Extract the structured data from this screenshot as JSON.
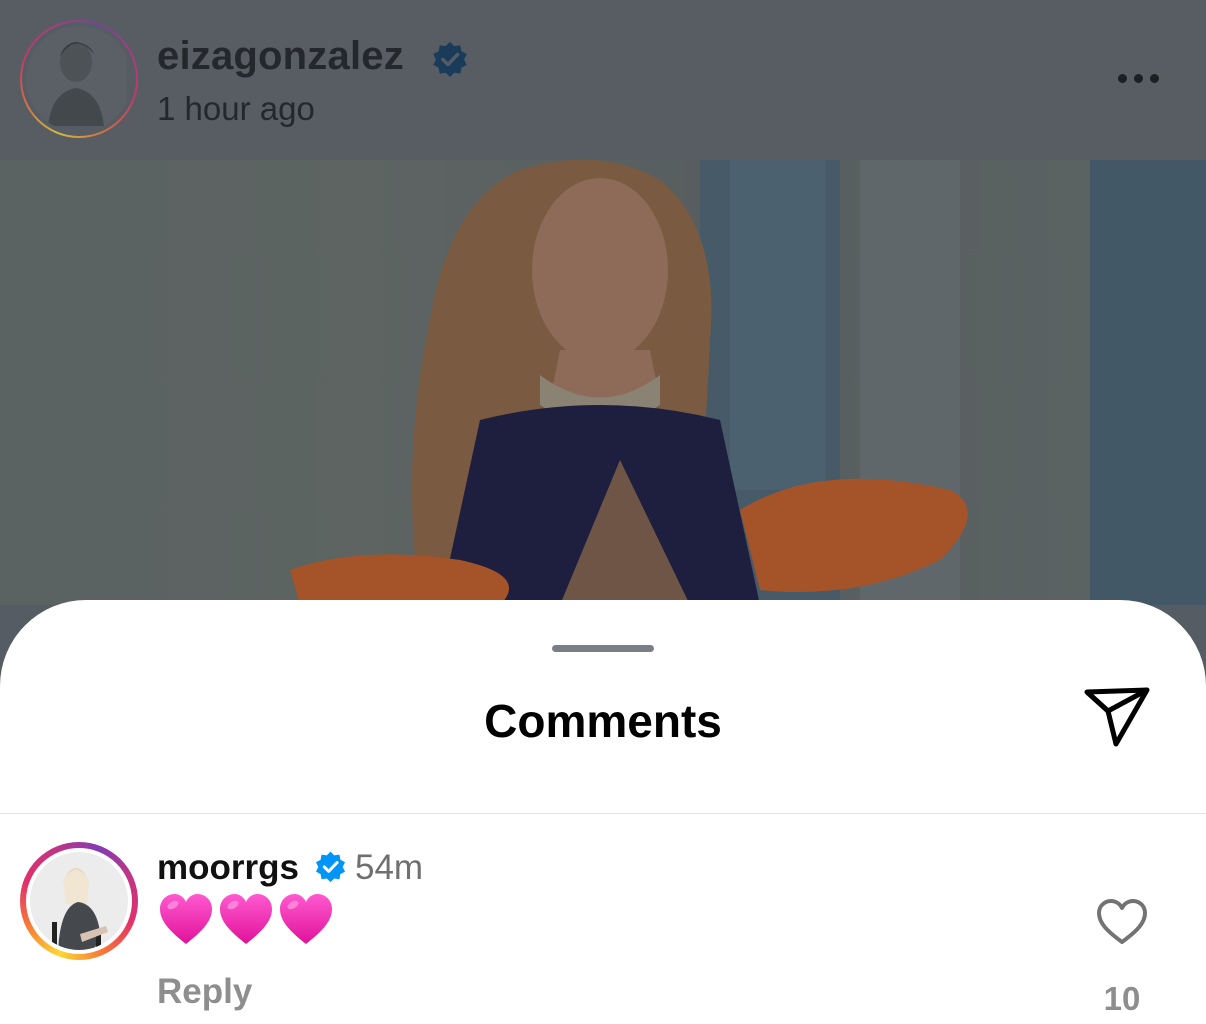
{
  "post": {
    "username": "eizagonzalez",
    "verified": true,
    "timestamp": "1 hour ago"
  },
  "sheet": {
    "title": "Comments"
  },
  "comment": {
    "username": "moorrgs",
    "verified": true,
    "time": "54m",
    "text": "💗💗💗",
    "reply_label": "Reply",
    "like_count": "10"
  },
  "icons": {
    "more": "more-horizontal-icon",
    "share": "paper-plane-icon",
    "like": "heart-outline-icon",
    "verified": "verified-badge-icon"
  },
  "colors": {
    "verified": "#0095f6",
    "heart": "#f21fa8",
    "overlay": "#565c63"
  }
}
